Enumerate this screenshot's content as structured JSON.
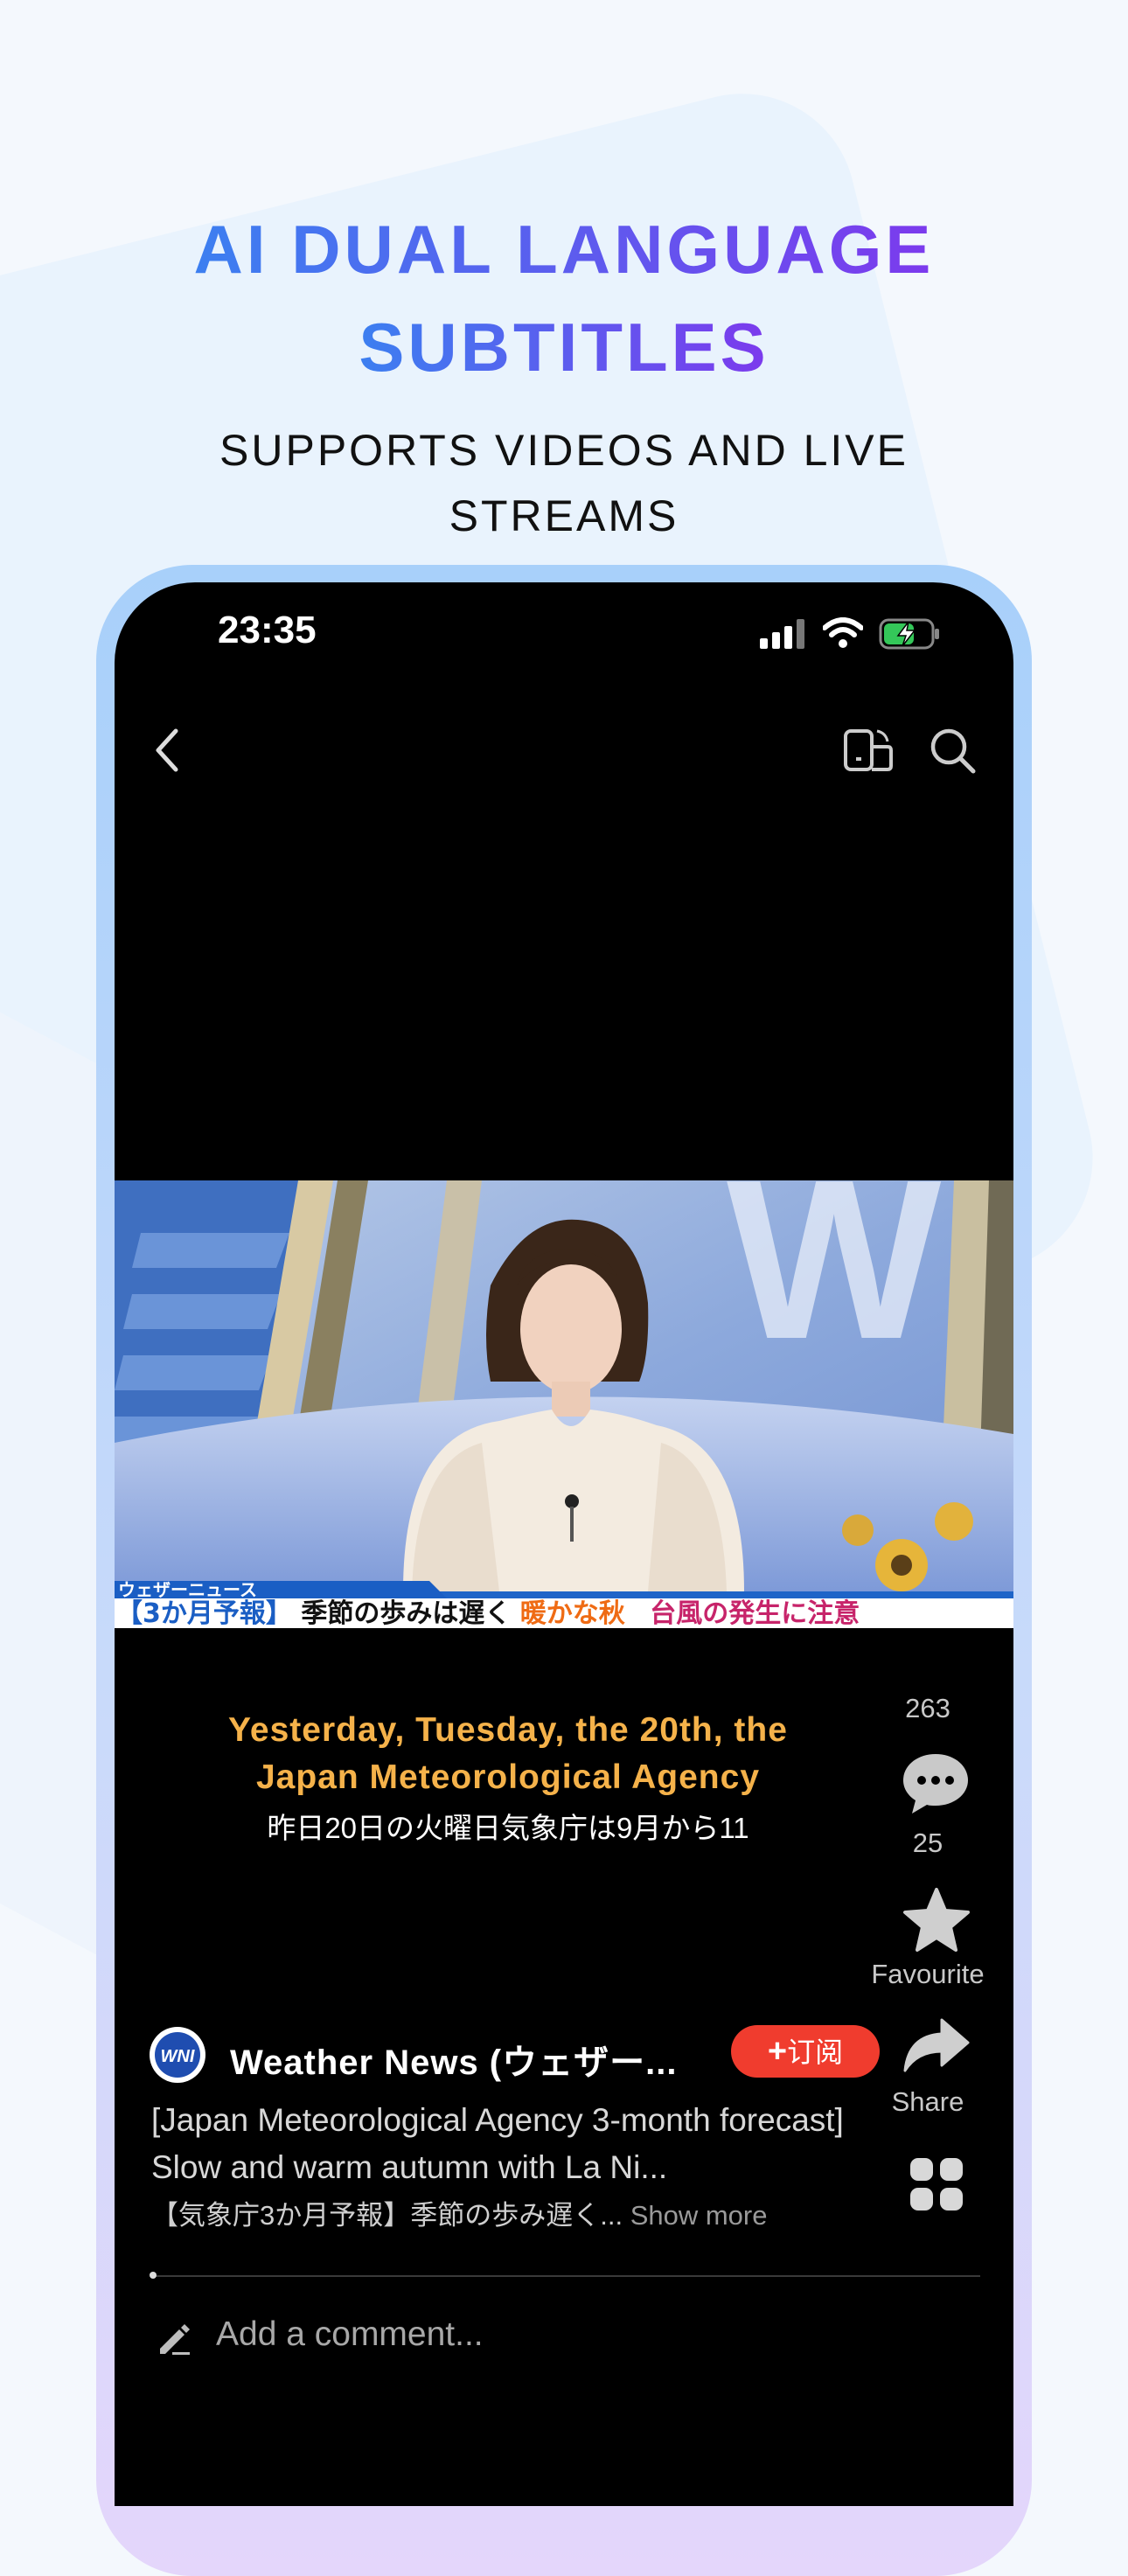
{
  "promo": {
    "title_line1": "AI DUAL LANGUAGE",
    "title_line2": "SUBTITLES",
    "subtitle_line1": "SUPPORTS VIDEOS AND LIVE",
    "subtitle_line2": "STREAMS"
  },
  "status_bar": {
    "time": "23:35"
  },
  "video": {
    "banner_tag": "ウェザーニュース",
    "ticker_parts": [
      "【3か月予報】",
      "季節の歩みは遅く",
      "暖かな秋",
      "台風の発生に注意"
    ],
    "subtitle_en": "Yesterday, Tuesday, the 20th, the Japan Meteorological Agency",
    "subtitle_jp": "昨日20日の火曜日気象庁は9月から11"
  },
  "actions": {
    "likes_count": "263",
    "comments_count": "25",
    "favourite_label": "Favourite",
    "share_label": "Share"
  },
  "channel": {
    "logo_text": "WNI",
    "name": "Weather News (ウェザー...",
    "subscribe_label": "订阅"
  },
  "description": {
    "text": "[Japan Meteorological Agency 3-month forecast] Slow and warm autumn with La Ni...",
    "japanese": "【気象庁3か月予報】季節の歩み遅く... ",
    "show_more": "Show more"
  },
  "comment": {
    "placeholder": "Add a comment..."
  },
  "colors": {
    "accent_start": "#3c7ff0",
    "accent_end": "#7c3aed",
    "subtitle_en": "#f5b24a",
    "subscribe": "#f03c2e",
    "battery_charging": "#34c759"
  },
  "icons": [
    "back-icon",
    "rotate-screen-icon",
    "search-icon",
    "chat-bubble-icon",
    "star-icon",
    "share-arrow-icon",
    "grid-apps-icon",
    "edit-pen-icon"
  ]
}
